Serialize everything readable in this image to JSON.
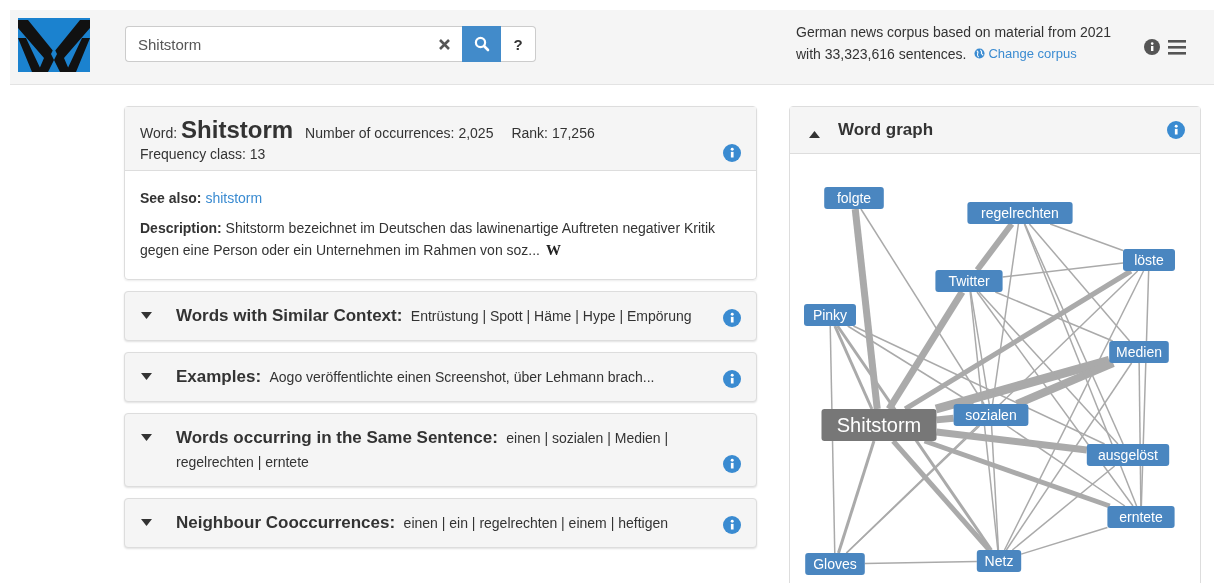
{
  "header": {
    "search": {
      "value": "Shitstorm"
    },
    "help_button": "?",
    "corpus": {
      "description": "German news corpus based on material from 2021 with 33,323,616 sentences.",
      "link": "Change corpus"
    }
  },
  "word_card": {
    "word_label": "Word:",
    "word": "Shitstorm",
    "occurrences": "Number of occurrences: 2,025",
    "rank": "Rank: 17,256",
    "frequency_class": "Frequency class: 13",
    "see_also_label": "See also:",
    "see_also_link": "shitstorm",
    "description": "**Description:** Shitstorm bezeichnet im Deutschen das lawinenartige Auftreten negativer Kritik gegen eine Person oder ein Unternehmen im Rahmen von soz...",
    "source_icon": "W"
  },
  "sections": [
    {
      "title": "Words with Similar Context:",
      "summary": "Entrüstung | Spott | Häme | Hype | Empörung",
      "expanded": false
    },
    {
      "title": "Examples:",
      "summary": "Aogo veröffentlichte einen Screenshot, über Lehmann brach...",
      "expanded": false
    },
    {
      "title": "Words occurring in the Same Sentence:",
      "summary": "einen | sozialen | Medien | regelrechten | erntete",
      "expanded": false
    },
    {
      "title": "Neighbour Cooccurrences:",
      "summary": "einen | ein | regelrechten | einem | heftigen",
      "expanded": false
    }
  ],
  "word_graph": {
    "title": "Word graph",
    "expanded": true,
    "nodes": [
      {
        "label": "folgte",
        "kind": "neighbour"
      },
      {
        "label": "regelrechten",
        "kind": "neighbour"
      },
      {
        "label": "löste",
        "kind": "neighbour"
      },
      {
        "label": "Twitter",
        "kind": "neighbour"
      },
      {
        "label": "Pinky",
        "kind": "neighbour"
      },
      {
        "label": "Medien",
        "kind": "neighbour"
      },
      {
        "label": "Shitstorm",
        "kind": "center"
      },
      {
        "label": "sozialen",
        "kind": "neighbour"
      },
      {
        "label": "ausgelöst",
        "kind": "neighbour"
      },
      {
        "label": "erntete",
        "kind": "neighbour"
      },
      {
        "label": "Gloves",
        "kind": "neighbour"
      },
      {
        "label": "Netz",
        "kind": "neighbour"
      }
    ]
  }
}
